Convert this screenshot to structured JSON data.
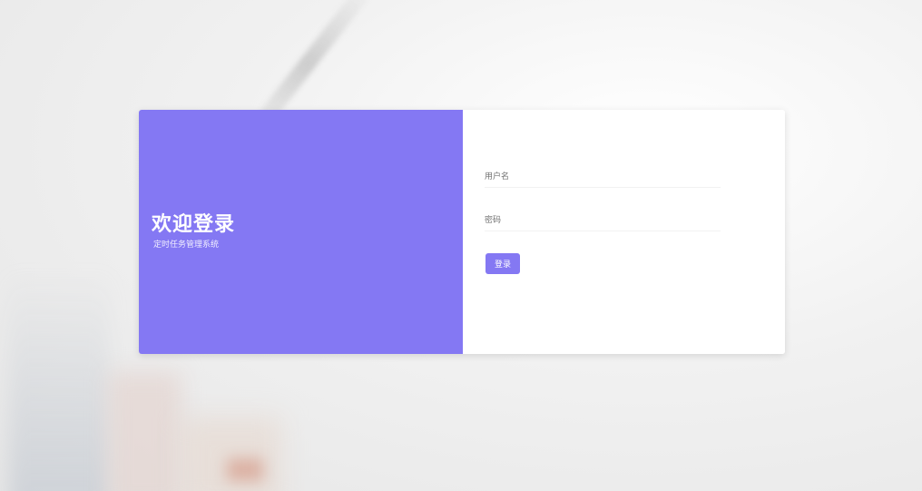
{
  "welcome": {
    "title": "欢迎登录",
    "subtitle": "定时任务管理系统"
  },
  "form": {
    "username_placeholder": "用户名",
    "username_value": "",
    "password_placeholder": "密码",
    "password_value": "",
    "login_label": "登录"
  },
  "colors": {
    "accent": "#8478f3",
    "panel_text": "#ffffff",
    "card_bg": "#ffffff"
  }
}
